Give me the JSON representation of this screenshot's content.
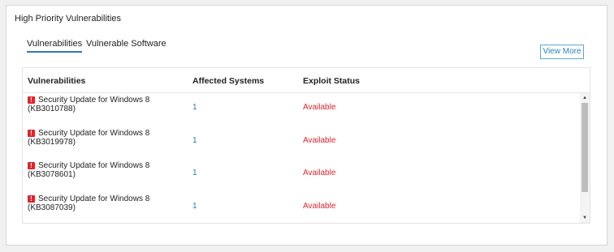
{
  "card": {
    "title": "High Priority Vulnerabilities"
  },
  "tabs": [
    {
      "label": "Vulnerabilities",
      "active": true
    },
    {
      "label": "Vulnerable Software",
      "active": false
    }
  ],
  "view_more_label": "View More",
  "table": {
    "headers": [
      "Vulnerabilities",
      "Affected Systems",
      "Exploit Status"
    ],
    "rows": [
      {
        "title": "Security Update for Windows 8",
        "kb": "(KB3010788)",
        "affected": "1",
        "status": "Available"
      },
      {
        "title": "Security Update for Windows 8",
        "kb": "(KB3019978)",
        "affected": "1",
        "status": "Available"
      },
      {
        "title": "Security Update for Windows 8",
        "kb": "(KB3078601)",
        "affected": "1",
        "status": "Available"
      },
      {
        "title": "Security Update for Windows 8",
        "kb": "(KB3087039)",
        "affected": "1",
        "status": "Available"
      }
    ]
  },
  "icons": {
    "alert": "alert-icon",
    "scroll_up": "scroll-up-icon",
    "scroll_down": "scroll-down-icon"
  },
  "colors": {
    "accent": "#2f79b5",
    "danger": "#e0242d",
    "button_border": "#5aa9cc"
  }
}
